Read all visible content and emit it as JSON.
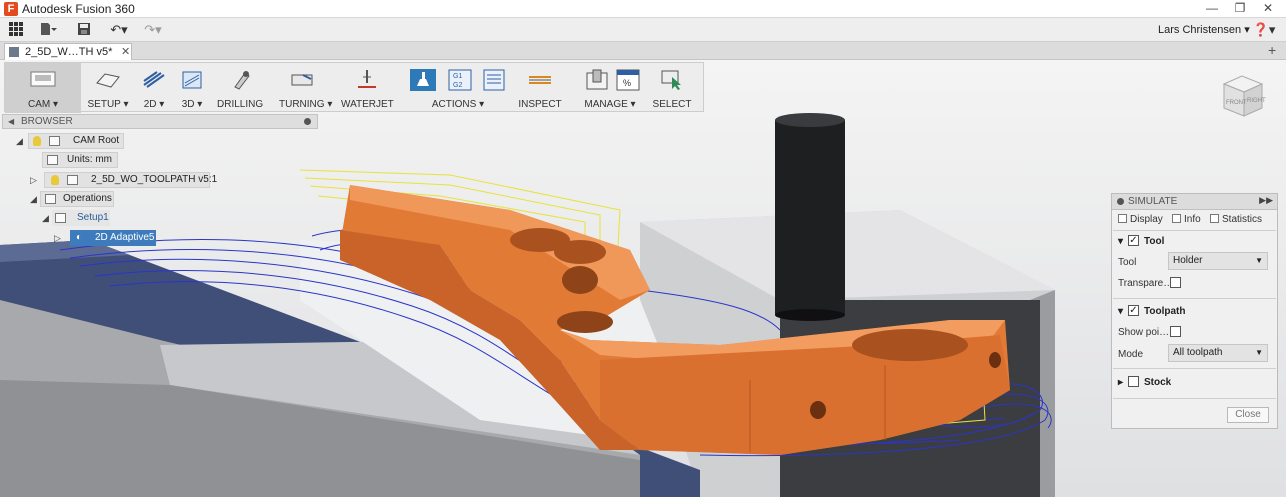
{
  "window": {
    "app_icon_letter": "F",
    "title": "Autodesk Fusion 360"
  },
  "quickbar": {
    "user_name": "Lars Christensen"
  },
  "document_tab": {
    "name": "2_5D_W…TH v5*",
    "close": "✕"
  },
  "toolbar": {
    "items": [
      {
        "label": "CAM ▾",
        "icon": "cam-workspace-icon"
      },
      {
        "label": "SETUP ▾",
        "icon": "setup-icon"
      },
      {
        "label": "2D ▾",
        "icon": "2d-toolpath-icon"
      },
      {
        "label": "3D ▾",
        "icon": "3d-toolpath-icon"
      },
      {
        "label": "DRILLING",
        "icon": "drill-icon"
      },
      {
        "label": "TURNING ▾",
        "icon": "turning-icon"
      },
      {
        "label": "WATERJET",
        "icon": "waterjet-icon"
      },
      {
        "label": "ACTIONS ▾",
        "icon": "simulate-icon"
      },
      {
        "label": "INSPECT",
        "icon": "inspect-icon"
      },
      {
        "label": "MANAGE ▾",
        "icon": "tool-library-icon"
      },
      {
        "label": "SELECT",
        "icon": "select-icon"
      }
    ],
    "gcode_icon_text": "G1\nG2"
  },
  "browser": {
    "title": "BROWSER",
    "nodes": {
      "cam_root": "CAM Root",
      "units": "Units: mm",
      "model": "2_5D_WO_TOOLPATH v5:1",
      "operations": "Operations",
      "setup": "Setup1",
      "operation": "2D Adaptive5"
    }
  },
  "simulate": {
    "title": "SIMULATE",
    "tabs": [
      "Display",
      "Info",
      "Statistics"
    ],
    "tool_section": "Tool",
    "tool_label": "Tool",
    "tool_value": "Holder",
    "transparent_label": "Transpare…",
    "toolpath_section": "Toolpath",
    "show_points_label": "Show poi…",
    "mode_label": "Mode",
    "mode_value": "All toolpath",
    "stock_section": "Stock",
    "close_label": "Close",
    "tool_checked": true,
    "toolpath_checked": true,
    "transparent_checked": false,
    "show_points_checked": false,
    "stock_checked": false
  },
  "viewcube": {
    "front": "FRONT",
    "right": "RIGHT"
  },
  "colors": {
    "part_orange": "#e07a34",
    "toolpath_blue": "#2a35c8",
    "toolpath_yellow": "#e8e23a",
    "selection_blue": "#3d7bbd",
    "vise_blue": "#3f4f78"
  }
}
